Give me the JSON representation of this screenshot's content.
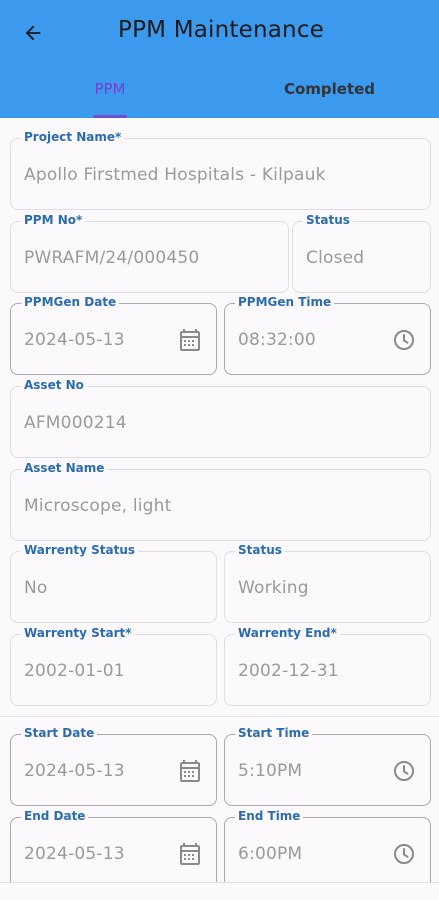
{
  "header": {
    "title": "PPM Maintenance",
    "back_icon": "arrow-left-icon",
    "bg_color": "#3b9aee"
  },
  "tabs": [
    {
      "label": "PPM",
      "active": true
    },
    {
      "label": "Completed",
      "active": false
    }
  ],
  "fields": {
    "project_name": {
      "label": "Project Name*",
      "value": "Apollo Firstmed Hospitals - Kilpauk"
    },
    "ppm_no": {
      "label": "PPM No*",
      "value": "PWRAFM/24/000450"
    },
    "ppm_status": {
      "label": "Status",
      "value": "Closed"
    },
    "ppmgen_date": {
      "label": "PPMGen Date",
      "value": "2024-05-13",
      "icon": "calendar-icon"
    },
    "ppmgen_time": {
      "label": "PPMGen Time",
      "value": "08:32:00",
      "icon": "clock-icon"
    },
    "asset_no": {
      "label": "Asset No",
      "value": "AFM000214"
    },
    "asset_name": {
      "label": "Asset Name",
      "value": "Microscope, light"
    },
    "warrenty_status": {
      "label": "Warrenty Status",
      "value": "No"
    },
    "asset_status": {
      "label": "Status",
      "value": "Working"
    },
    "warrenty_start": {
      "label": "Warrenty Start*",
      "value": "2002-01-01"
    },
    "warrenty_end": {
      "label": "Warrenty End*",
      "value": "2002-12-31"
    },
    "start_date": {
      "label": "Start Date",
      "value": "2024-05-13",
      "icon": "calendar-icon"
    },
    "start_time": {
      "label": "Start Time",
      "value": "5:10PM",
      "icon": "clock-icon"
    },
    "end_date": {
      "label": "End Date",
      "value": "2024-05-13",
      "icon": "calendar-icon"
    },
    "end_time": {
      "label": "End Time",
      "value": "6:00PM",
      "icon": "clock-icon"
    }
  }
}
